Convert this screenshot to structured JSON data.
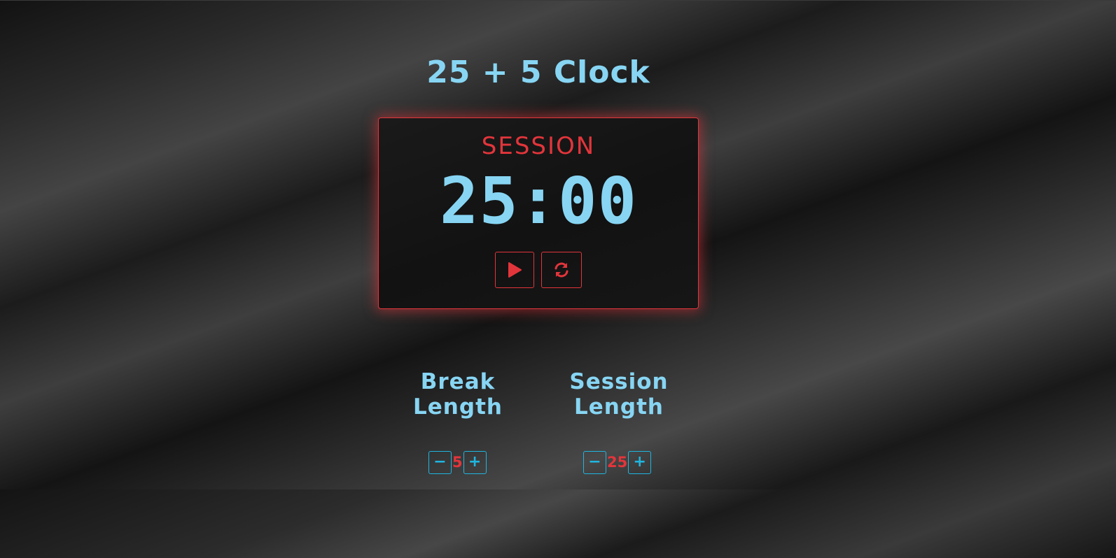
{
  "app": {
    "title": "25 + 5 Clock"
  },
  "timer": {
    "label": "SESSION",
    "time_left": "25:00",
    "start_icon": "play-icon",
    "reset_icon": "refresh-icon"
  },
  "break_length": {
    "label": "Break Length",
    "value": "5",
    "decrement_label": "−",
    "increment_label": "+"
  },
  "session_length": {
    "label": "Session Length",
    "value": "25",
    "decrement_label": "−",
    "increment_label": "+"
  },
  "colors": {
    "accent_blue": "#87d5f3",
    "accent_red": "#e2353b",
    "button_blue": "#1fb6e0",
    "background": "#1a1a1a"
  }
}
